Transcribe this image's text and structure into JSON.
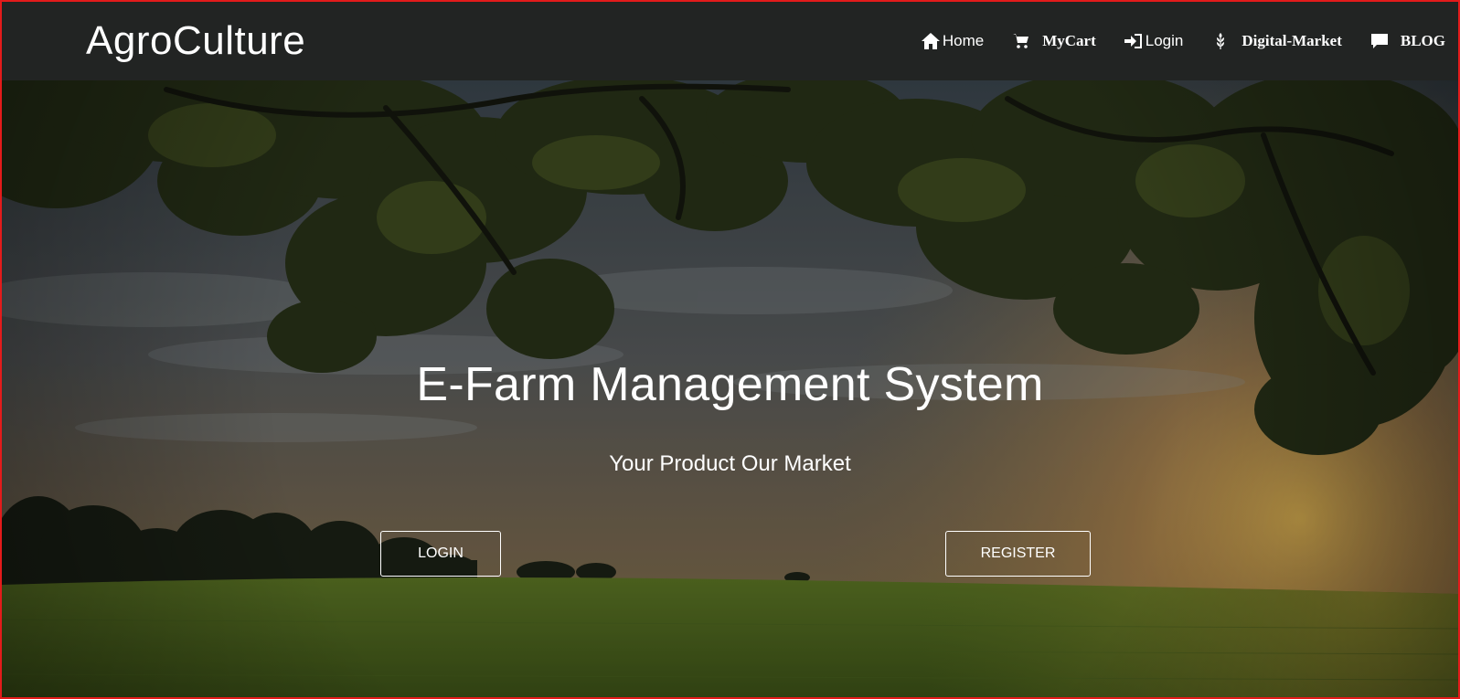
{
  "brand": {
    "name": "AgroCulture"
  },
  "nav": {
    "items": [
      {
        "label": "Home",
        "icon": "home-icon"
      },
      {
        "label": "MyCart",
        "icon": "cart-icon"
      },
      {
        "label": "Login",
        "icon": "login-icon"
      },
      {
        "label": "Digital-Market",
        "icon": "grain-icon"
      },
      {
        "label": "BLOG",
        "icon": "comment-icon"
      }
    ]
  },
  "hero": {
    "title": "E-Farm Management System",
    "subtitle": "Your Product Our Market",
    "login_label": "LOGIN",
    "register_label": "REGISTER"
  },
  "colors": {
    "navbar_bg": "#222423",
    "frame_border": "#e31b1b",
    "text": "#ffffff"
  }
}
